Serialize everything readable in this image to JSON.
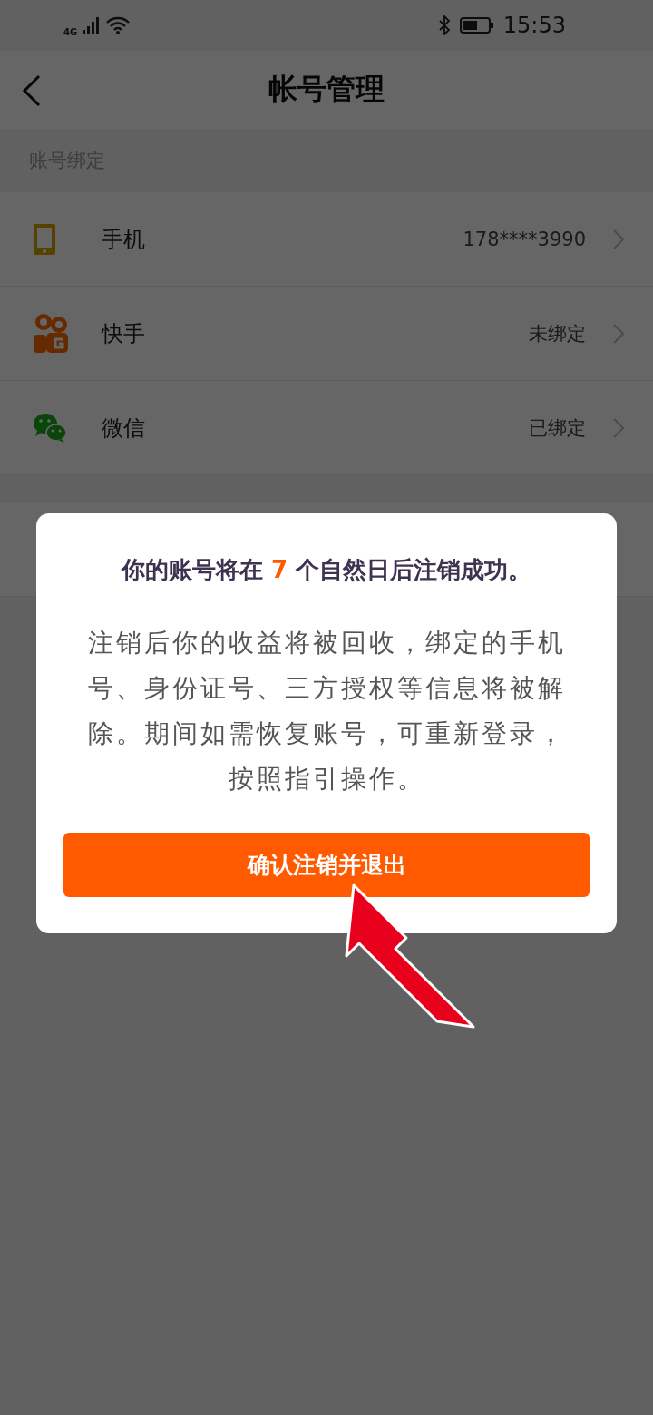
{
  "status_bar": {
    "network": "4G",
    "time": "15:53"
  },
  "header": {
    "title": "帐号管理"
  },
  "section": {
    "title": "账号绑定"
  },
  "bindings": [
    {
      "kind": "phone",
      "label": "手机",
      "value": "178****3990"
    },
    {
      "kind": "kuaishou",
      "label": "快手",
      "value": "未绑定"
    },
    {
      "kind": "wechat",
      "label": "微信",
      "value": "已绑定"
    }
  ],
  "dialog": {
    "title_before": "你的账号将在",
    "highlight": "7",
    "title_after": "个自然日后注销成功。",
    "message": "注销后你的收益将被回收，绑定的手机号、身份证号、三方授权等信息将被解除。期间如需恢复账号，可重新登录，按照指引操作。",
    "button": "确认注销并退出"
  }
}
